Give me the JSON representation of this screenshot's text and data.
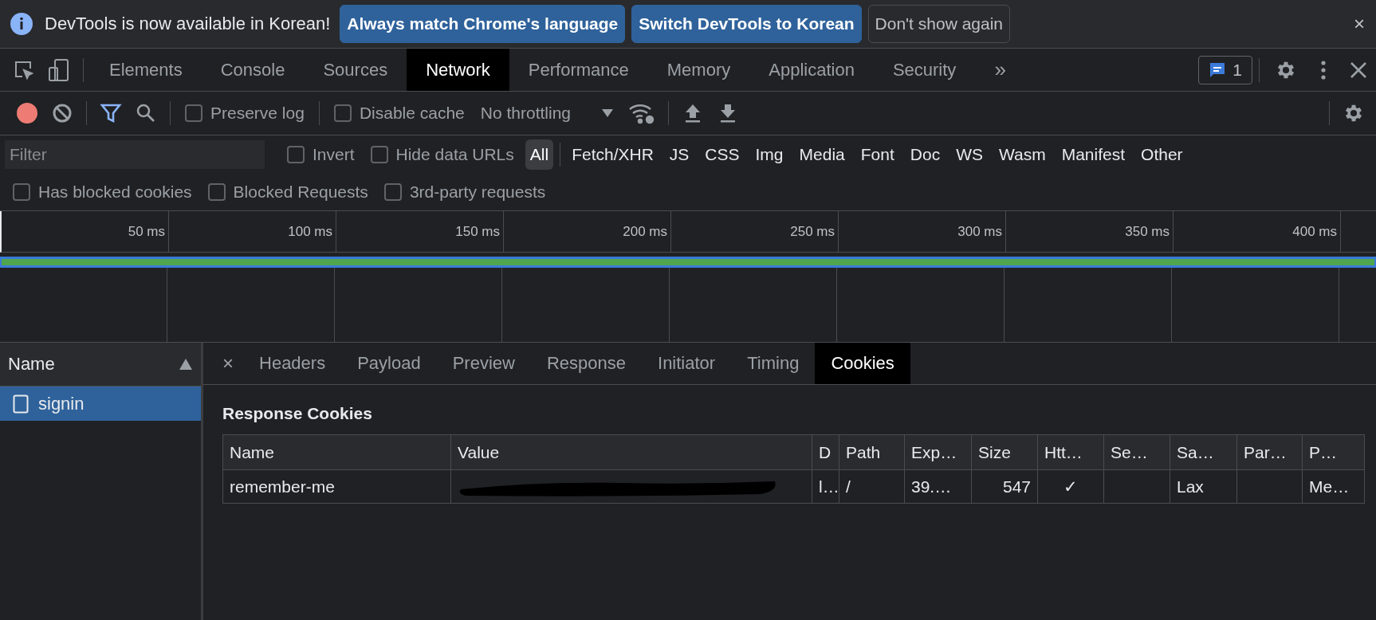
{
  "infobar": {
    "message": "DevTools is now available in Korean!",
    "buttons": [
      {
        "label": "Always match Chrome's language",
        "kind": "primary"
      },
      {
        "label": "Switch DevTools to Korean",
        "kind": "primary"
      },
      {
        "label": "Don't show again",
        "kind": "outline"
      }
    ],
    "close": "×"
  },
  "main_tabs": [
    {
      "label": "Elements",
      "selected": false
    },
    {
      "label": "Console",
      "selected": false
    },
    {
      "label": "Sources",
      "selected": false
    },
    {
      "label": "Network",
      "selected": true
    },
    {
      "label": "Performance",
      "selected": false
    },
    {
      "label": "Memory",
      "selected": false
    },
    {
      "label": "Application",
      "selected": false
    },
    {
      "label": "Security",
      "selected": false
    }
  ],
  "more_tabs": "»",
  "issues_count": "1",
  "toolbar": {
    "recording": true,
    "filter_active": true,
    "checkboxes": [
      {
        "label": "Preserve log",
        "checked": false
      },
      {
        "label": "Disable cache",
        "checked": false
      }
    ],
    "throttling": "No throttling"
  },
  "filter": {
    "placeholder": "Filter",
    "checkboxes": [
      {
        "label": "Invert",
        "checked": false
      },
      {
        "label": "Hide data URLs",
        "checked": false
      }
    ],
    "types": [
      {
        "label": "All",
        "selected": true
      },
      {
        "label": "Fetch/XHR",
        "selected": false
      },
      {
        "label": "JS",
        "selected": false
      },
      {
        "label": "CSS",
        "selected": false
      },
      {
        "label": "Img",
        "selected": false
      },
      {
        "label": "Media",
        "selected": false
      },
      {
        "label": "Font",
        "selected": false
      },
      {
        "label": "Doc",
        "selected": false
      },
      {
        "label": "WS",
        "selected": false
      },
      {
        "label": "Wasm",
        "selected": false
      },
      {
        "label": "Manifest",
        "selected": false
      },
      {
        "label": "Other",
        "selected": false
      }
    ],
    "more_checkboxes": [
      {
        "label": "Has blocked cookies",
        "checked": false
      },
      {
        "label": "Blocked Requests",
        "checked": false
      },
      {
        "label": "3rd-party requests",
        "checked": false
      }
    ]
  },
  "timeline": {
    "ticks": [
      "50 ms",
      "100 ms",
      "150 ms",
      "200 ms",
      "250 ms",
      "300 ms",
      "350 ms",
      "400 ms"
    ]
  },
  "requests": {
    "column": "Name",
    "rows": [
      {
        "name": "signin",
        "selected": true
      }
    ]
  },
  "detail_tabs": [
    {
      "label": "Headers",
      "selected": false
    },
    {
      "label": "Payload",
      "selected": false
    },
    {
      "label": "Preview",
      "selected": false
    },
    {
      "label": "Response",
      "selected": false
    },
    {
      "label": "Initiator",
      "selected": false
    },
    {
      "label": "Timing",
      "selected": false
    },
    {
      "label": "Cookies",
      "selected": true
    }
  ],
  "detail_close": "×",
  "cookies": {
    "title": "Response Cookies",
    "columns": [
      "Name",
      "Value",
      "D",
      "Path",
      "Exp…",
      "Size",
      "Htt…",
      "Se…",
      "Sa…",
      "Par…",
      "P…"
    ],
    "rows": [
      {
        "cells": [
          {
            "text": "remember-me"
          },
          {
            "text": "",
            "redacted": true
          },
          {
            "text": "l…"
          },
          {
            "text": "/"
          },
          {
            "text": "39.…"
          },
          {
            "text": "547"
          },
          {
            "text": "✓"
          },
          {
            "text": ""
          },
          {
            "text": "Lax"
          },
          {
            "text": ""
          },
          {
            "text": "Me…"
          }
        ]
      }
    ]
  }
}
